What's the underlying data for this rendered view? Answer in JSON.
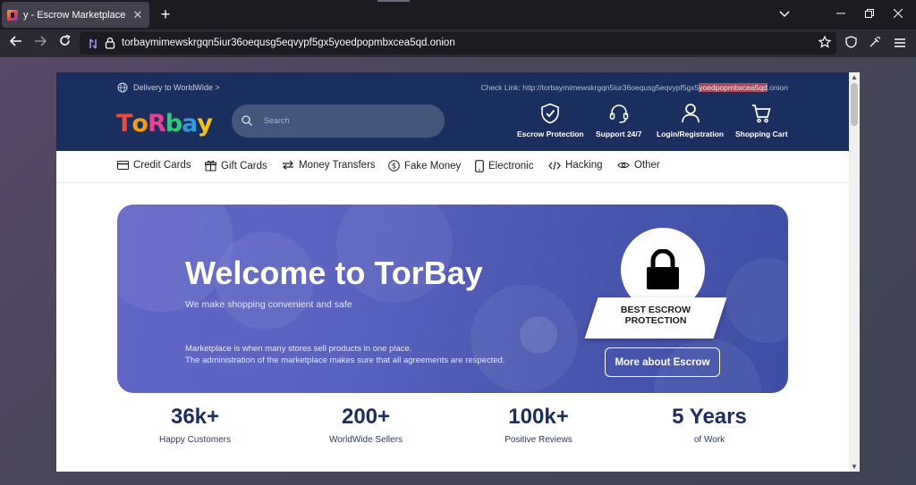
{
  "browser": {
    "tab_title": "y - Escrow Marketplace - TorBa",
    "tab_close": "✕",
    "new_tab": "+",
    "url": "torbaymimewskrgqn5iur36oequsg5eqvypf5gx5yoedpopmbxcea5qd.onion"
  },
  "header": {
    "delivery": "Delivery to WorldWide >",
    "check_link_prefix": "Check Link: http://torbaymimewskrgqn5iur36oequsg5eqvypf5gx5",
    "check_link_highlight": "yoedpopmbxcea5qd",
    "check_link_suffix": ".onion",
    "logo": [
      "T",
      "o",
      "R",
      "b",
      "a",
      "y"
    ],
    "logo_colors": [
      "#e74c3c",
      "#f39c12",
      "#e84393",
      "#2ecc71",
      "#3498db",
      "#f1c40f"
    ],
    "search_placeholder": "Search",
    "links": {
      "escrow": "Escrow Protection",
      "support": "Support 24/7",
      "login": "Login/Registration",
      "cart": "Shopping Cart"
    }
  },
  "categories": {
    "credit_cards": "Credit Cards",
    "gift_cards": "Gift Cards",
    "money_transfers": "Money Transfers",
    "fake_money": "Fake Money",
    "electronic": "Electronic",
    "hacking": "Hacking",
    "other": "Other"
  },
  "banner": {
    "title": "Welcome to TorBay",
    "subtitle": "We make shopping convenient and safe",
    "desc1": "Marketplace is when many stores sell products in one place.",
    "desc2": "The administration of the marketplace makes sure that all agreements are respected.",
    "badge_line1": "BEST ESCROW",
    "badge_line2": "PROTECTION",
    "button": "More about Escrow"
  },
  "stats": [
    {
      "num": "36k+",
      "label": "Happy Customers"
    },
    {
      "num": "200+",
      "label": "WorldWide Sellers"
    },
    {
      "num": "100k+",
      "label": "Positive Reviews"
    },
    {
      "num": "5 Years",
      "label": "of Work"
    }
  ]
}
